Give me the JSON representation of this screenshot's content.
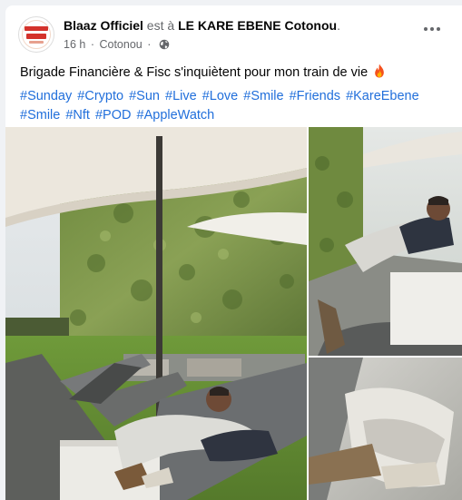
{
  "post": {
    "author": "Blaaz Officiel",
    "connector": " est à ",
    "location": "LE KARE EBENE Cotonou",
    "location_suffix": ".",
    "time": "16 h",
    "separator": "·",
    "city": "Cotonou",
    "privacy_icon": "globe-icon",
    "more_icon": "more-options-icon",
    "text": "Brigade Financière & Fisc s'inquiètent pour mon train de vie",
    "emoji_icon": "fire-icon",
    "hashtags": [
      "#Sunday",
      "#Crypto",
      "#Sun",
      "#Live",
      "#Love",
      "#Smile",
      "#Friends",
      "#KareEbene",
      "#Smile",
      "#Nft",
      "#POD",
      "#AppleWatch"
    ]
  },
  "colors": {
    "link": "#216fdb",
    "secondary_text": "#65676b",
    "primary_text": "#050505",
    "background": "#f0f2f5"
  }
}
